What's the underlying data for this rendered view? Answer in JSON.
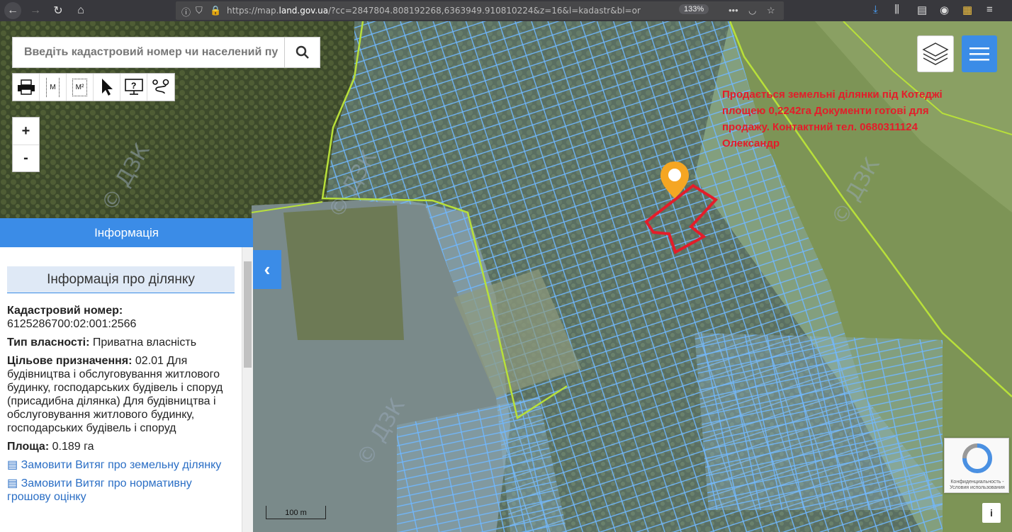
{
  "browser": {
    "url_prefix": "https://map.",
    "url_domain": "land.gov.ua",
    "url_rest": "/?cc=2847804.808192268,6363949.910810224&z=16&l=kadastr&bl=or",
    "zoom": "133%"
  },
  "search": {
    "placeholder": "Введіть кадастровий номер чи населений пу"
  },
  "toolbar": {
    "tools": [
      "print-icon",
      "measure-length-icon",
      "measure-area-icon",
      "pointer-icon",
      "info-query-icon",
      "route-icon"
    ],
    "measure_length_label": "M",
    "measure_area_label": "M²"
  },
  "zoom": {
    "in": "+",
    "out": "-"
  },
  "panel": {
    "header": "Інформація",
    "subheader": "Інформація про ділянку",
    "cadastral_label": "Кадастровий номер:",
    "cadastral_value": "6125286700:02:001:2566",
    "ownership_label": "Тип власності:",
    "ownership_value": "Приватна власність",
    "purpose_label": "Цільове призначення:",
    "purpose_value": "02.01 Для будівництва і обслуговування житлового будинку, господарських будівель і споруд (присадибна ділянка) Для будівництва і обслуговування житлового будинку, господарських будівель і споруд",
    "area_label": "Площа:",
    "area_value": "0.189 га",
    "link1": "Замовити Витяг про земельну ділянку",
    "link2": "Замовити Витяг про нормативну грошову оцінку"
  },
  "map": {
    "ad_text": "Продається земельні ділянки під Котеджі площею 0,2242га Документи готові для продажу. Контактний тел. 0680311124 Олександр",
    "scale_label": "100 m",
    "watermark": "© ДЗК"
  },
  "recaptcha": {
    "text": "Конфиденциальность - Условия использования"
  },
  "info_button": "i",
  "colors": {
    "accent": "#3b8ce7",
    "parcel": "#6fb7ff",
    "boundary": "#b8e03a",
    "highlight": "#e31d2a",
    "pin": "#f5a623"
  }
}
